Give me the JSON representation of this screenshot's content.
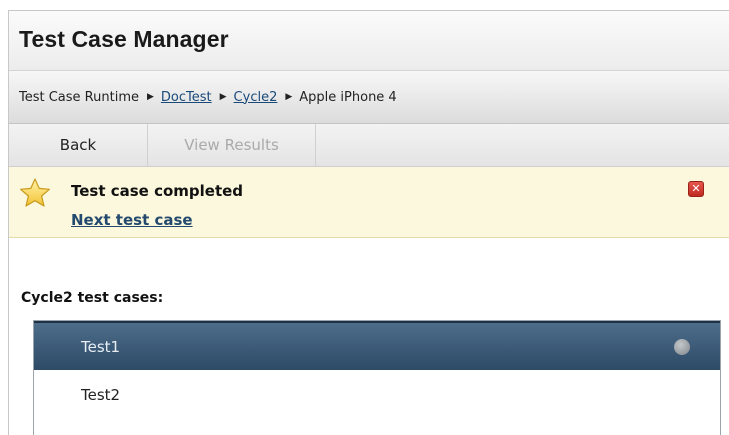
{
  "app": {
    "title": "Test Case Manager"
  },
  "breadcrumb": {
    "root": "Test Case Runtime",
    "items": [
      {
        "label": "DocTest",
        "link": true
      },
      {
        "label": "Cycle2",
        "link": true
      },
      {
        "label": "Apple iPhone 4",
        "link": false
      }
    ]
  },
  "toolbar": {
    "back_label": "Back",
    "view_results_label": "View Results"
  },
  "notice": {
    "message": "Test case completed",
    "next_link": "Next test case",
    "icon": "star-icon",
    "close_icon": "close-icon"
  },
  "test_cases": {
    "label": "Cycle2 test cases:",
    "items": [
      {
        "name": "Test1",
        "selected": true,
        "status_icon": "status-dot-icon"
      },
      {
        "name": "Test2",
        "selected": false
      }
    ]
  },
  "colors": {
    "notice_bg": "#fbf8dd",
    "selected_row": "#2d4a66",
    "link": "#1a4a7a",
    "close_red": "#c02a20"
  }
}
